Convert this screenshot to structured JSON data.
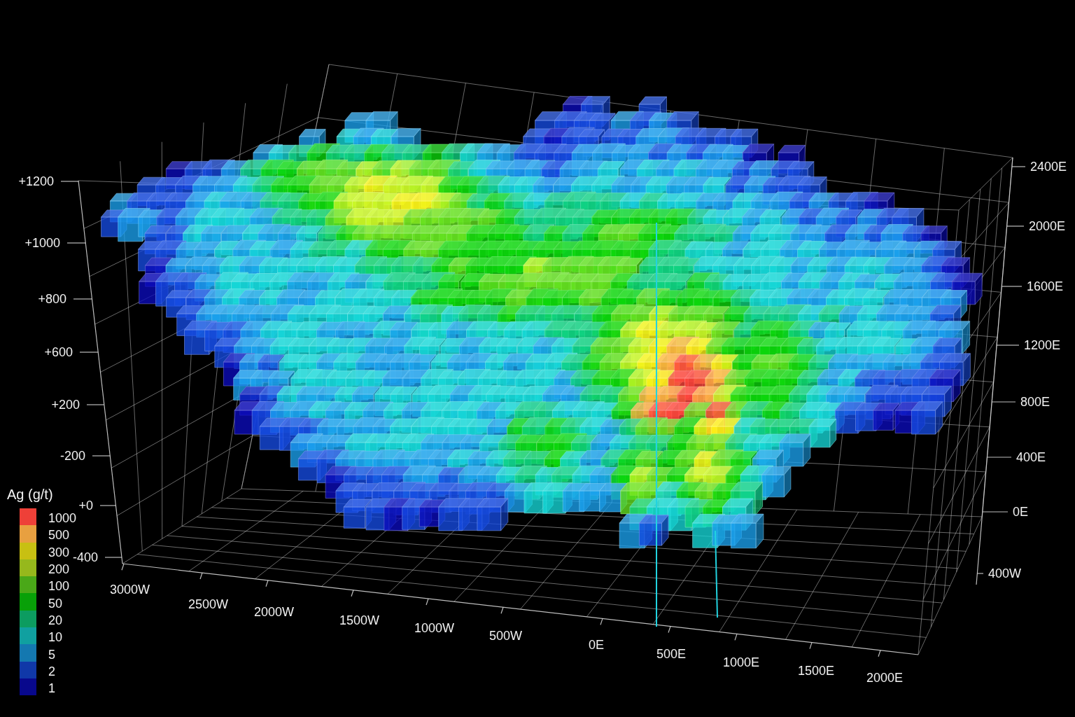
{
  "left_axis": {
    "tick_labels": [
      "+1200",
      "+1000",
      "+800",
      "+600",
      "+200",
      "-200",
      "+0",
      "-400"
    ]
  },
  "right_axis": {
    "tick_labels": [
      "2400E",
      "2000E",
      "1600E",
      "1200E",
      "800E",
      "400E",
      "0E",
      "400W"
    ]
  },
  "bottom_axis": {
    "tick_labels": [
      "3000W",
      "2500W",
      "2000W",
      "1500W",
      "1000W",
      "500W",
      "0E",
      "500E",
      "1000E",
      "1500E",
      "2000E"
    ]
  },
  "legend": {
    "title": "Ag (g/t)",
    "items": [
      {
        "label": "1000",
        "color": "#ee4038"
      },
      {
        "label": "500",
        "color": "#e8a040"
      },
      {
        "label": "300",
        "color": "#c8c012"
      },
      {
        "label": "200",
        "color": "#96b81c"
      },
      {
        "label": "100",
        "color": "#4aa818"
      },
      {
        "label": "50",
        "color": "#08a008"
      },
      {
        "label": "20",
        "color": "#0c9c60"
      },
      {
        "label": "10",
        "color": "#10a0a0"
      },
      {
        "label": "5",
        "color": "#1478b0"
      },
      {
        "label": "2",
        "color": "#1038a8"
      },
      {
        "label": "1",
        "color": "#08088c"
      }
    ]
  }
}
